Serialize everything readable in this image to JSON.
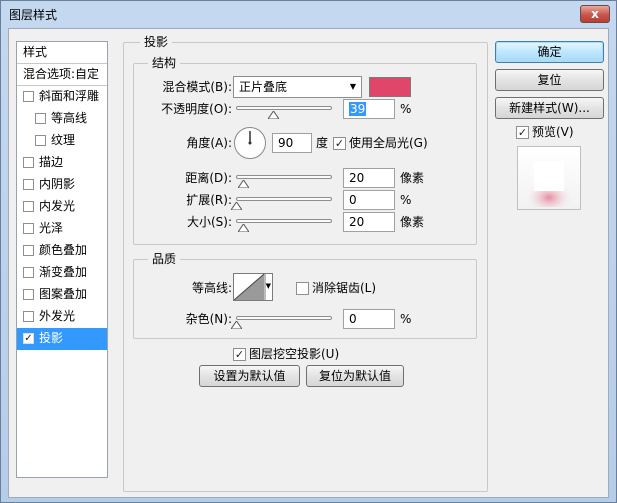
{
  "window": {
    "title": "图层样式",
    "close_icon": "close-icon"
  },
  "sidebar": {
    "header": "样式",
    "blend_options": "混合选项:自定",
    "items": [
      {
        "label": "斜面和浮雕",
        "checked": false,
        "sub": false
      },
      {
        "label": "等高线",
        "checked": false,
        "sub": true
      },
      {
        "label": "纹理",
        "checked": false,
        "sub": true
      },
      {
        "label": "描边",
        "checked": false,
        "sub": false
      },
      {
        "label": "内阴影",
        "checked": false,
        "sub": false
      },
      {
        "label": "内发光",
        "checked": false,
        "sub": false
      },
      {
        "label": "光泽",
        "checked": false,
        "sub": false
      },
      {
        "label": "颜色叠加",
        "checked": false,
        "sub": false
      },
      {
        "label": "渐变叠加",
        "checked": false,
        "sub": false
      },
      {
        "label": "图案叠加",
        "checked": false,
        "sub": false
      },
      {
        "label": "外发光",
        "checked": false,
        "sub": false
      },
      {
        "label": "投影",
        "checked": true,
        "sub": false,
        "selected": true
      }
    ]
  },
  "shadow": {
    "section_title": "投影",
    "structure_title": "结构",
    "blend_mode_label": "混合模式(B):",
    "blend_mode_value": "正片叠底",
    "shadow_color": "#e0456a",
    "opacity_label": "不透明度(O):",
    "opacity_value": "39",
    "percent": "%",
    "angle_label": "角度(A):",
    "angle_value": "90",
    "angle_unit": "度",
    "global_light_label": "使用全局光(G)",
    "global_light_checked": true,
    "distance_label": "距离(D):",
    "distance_value": "20",
    "pixel_unit": "像素",
    "spread_label": "扩展(R):",
    "spread_value": "0",
    "size_label": "大小(S):",
    "size_value": "20",
    "quality_title": "品质",
    "contour_label": "等高线:",
    "anti_alias_label": "消除锯齿(L)",
    "anti_alias_checked": false,
    "noise_label": "杂色(N):",
    "noise_value": "0",
    "knockout_label": "图层挖空投影(U)",
    "knockout_checked": true,
    "make_default_label": "设置为默认值",
    "reset_default_label": "复位为默认值",
    "slider_levels": {
      "opacity": 0.39,
      "distance": 0.08,
      "spread": 0.0,
      "size": 0.08,
      "noise": 0.0
    }
  },
  "actions": {
    "ok_label": "确定",
    "reset_label": "复位",
    "new_style_label": "新建样式(W)...",
    "preview_label": "预览(V)",
    "preview_checked": true
  },
  "check_glyph": "✓",
  "dropdown_arrow": "▼",
  "close_glyph": "x"
}
